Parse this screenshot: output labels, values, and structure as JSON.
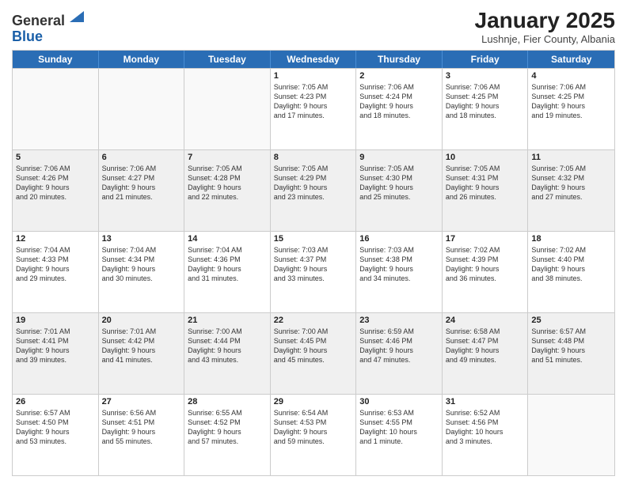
{
  "logo": {
    "line1": "General",
    "line2": "Blue"
  },
  "title": "January 2025",
  "subtitle": "Lushnje, Fier County, Albania",
  "days": [
    "Sunday",
    "Monday",
    "Tuesday",
    "Wednesday",
    "Thursday",
    "Friday",
    "Saturday"
  ],
  "weeks": [
    [
      {
        "day": "",
        "info": ""
      },
      {
        "day": "",
        "info": ""
      },
      {
        "day": "",
        "info": ""
      },
      {
        "day": "1",
        "info": "Sunrise: 7:05 AM\nSunset: 4:23 PM\nDaylight: 9 hours\nand 17 minutes."
      },
      {
        "day": "2",
        "info": "Sunrise: 7:06 AM\nSunset: 4:24 PM\nDaylight: 9 hours\nand 18 minutes."
      },
      {
        "day": "3",
        "info": "Sunrise: 7:06 AM\nSunset: 4:25 PM\nDaylight: 9 hours\nand 18 minutes."
      },
      {
        "day": "4",
        "info": "Sunrise: 7:06 AM\nSunset: 4:25 PM\nDaylight: 9 hours\nand 19 minutes."
      }
    ],
    [
      {
        "day": "5",
        "info": "Sunrise: 7:06 AM\nSunset: 4:26 PM\nDaylight: 9 hours\nand 20 minutes."
      },
      {
        "day": "6",
        "info": "Sunrise: 7:06 AM\nSunset: 4:27 PM\nDaylight: 9 hours\nand 21 minutes."
      },
      {
        "day": "7",
        "info": "Sunrise: 7:05 AM\nSunset: 4:28 PM\nDaylight: 9 hours\nand 22 minutes."
      },
      {
        "day": "8",
        "info": "Sunrise: 7:05 AM\nSunset: 4:29 PM\nDaylight: 9 hours\nand 23 minutes."
      },
      {
        "day": "9",
        "info": "Sunrise: 7:05 AM\nSunset: 4:30 PM\nDaylight: 9 hours\nand 25 minutes."
      },
      {
        "day": "10",
        "info": "Sunrise: 7:05 AM\nSunset: 4:31 PM\nDaylight: 9 hours\nand 26 minutes."
      },
      {
        "day": "11",
        "info": "Sunrise: 7:05 AM\nSunset: 4:32 PM\nDaylight: 9 hours\nand 27 minutes."
      }
    ],
    [
      {
        "day": "12",
        "info": "Sunrise: 7:04 AM\nSunset: 4:33 PM\nDaylight: 9 hours\nand 29 minutes."
      },
      {
        "day": "13",
        "info": "Sunrise: 7:04 AM\nSunset: 4:34 PM\nDaylight: 9 hours\nand 30 minutes."
      },
      {
        "day": "14",
        "info": "Sunrise: 7:04 AM\nSunset: 4:36 PM\nDaylight: 9 hours\nand 31 minutes."
      },
      {
        "day": "15",
        "info": "Sunrise: 7:03 AM\nSunset: 4:37 PM\nDaylight: 9 hours\nand 33 minutes."
      },
      {
        "day": "16",
        "info": "Sunrise: 7:03 AM\nSunset: 4:38 PM\nDaylight: 9 hours\nand 34 minutes."
      },
      {
        "day": "17",
        "info": "Sunrise: 7:02 AM\nSunset: 4:39 PM\nDaylight: 9 hours\nand 36 minutes."
      },
      {
        "day": "18",
        "info": "Sunrise: 7:02 AM\nSunset: 4:40 PM\nDaylight: 9 hours\nand 38 minutes."
      }
    ],
    [
      {
        "day": "19",
        "info": "Sunrise: 7:01 AM\nSunset: 4:41 PM\nDaylight: 9 hours\nand 39 minutes."
      },
      {
        "day": "20",
        "info": "Sunrise: 7:01 AM\nSunset: 4:42 PM\nDaylight: 9 hours\nand 41 minutes."
      },
      {
        "day": "21",
        "info": "Sunrise: 7:00 AM\nSunset: 4:44 PM\nDaylight: 9 hours\nand 43 minutes."
      },
      {
        "day": "22",
        "info": "Sunrise: 7:00 AM\nSunset: 4:45 PM\nDaylight: 9 hours\nand 45 minutes."
      },
      {
        "day": "23",
        "info": "Sunrise: 6:59 AM\nSunset: 4:46 PM\nDaylight: 9 hours\nand 47 minutes."
      },
      {
        "day": "24",
        "info": "Sunrise: 6:58 AM\nSunset: 4:47 PM\nDaylight: 9 hours\nand 49 minutes."
      },
      {
        "day": "25",
        "info": "Sunrise: 6:57 AM\nSunset: 4:48 PM\nDaylight: 9 hours\nand 51 minutes."
      }
    ],
    [
      {
        "day": "26",
        "info": "Sunrise: 6:57 AM\nSunset: 4:50 PM\nDaylight: 9 hours\nand 53 minutes."
      },
      {
        "day": "27",
        "info": "Sunrise: 6:56 AM\nSunset: 4:51 PM\nDaylight: 9 hours\nand 55 minutes."
      },
      {
        "day": "28",
        "info": "Sunrise: 6:55 AM\nSunset: 4:52 PM\nDaylight: 9 hours\nand 57 minutes."
      },
      {
        "day": "29",
        "info": "Sunrise: 6:54 AM\nSunset: 4:53 PM\nDaylight: 9 hours\nand 59 minutes."
      },
      {
        "day": "30",
        "info": "Sunrise: 6:53 AM\nSunset: 4:55 PM\nDaylight: 10 hours\nand 1 minute."
      },
      {
        "day": "31",
        "info": "Sunrise: 6:52 AM\nSunset: 4:56 PM\nDaylight: 10 hours\nand 3 minutes."
      },
      {
        "day": "",
        "info": ""
      }
    ]
  ]
}
